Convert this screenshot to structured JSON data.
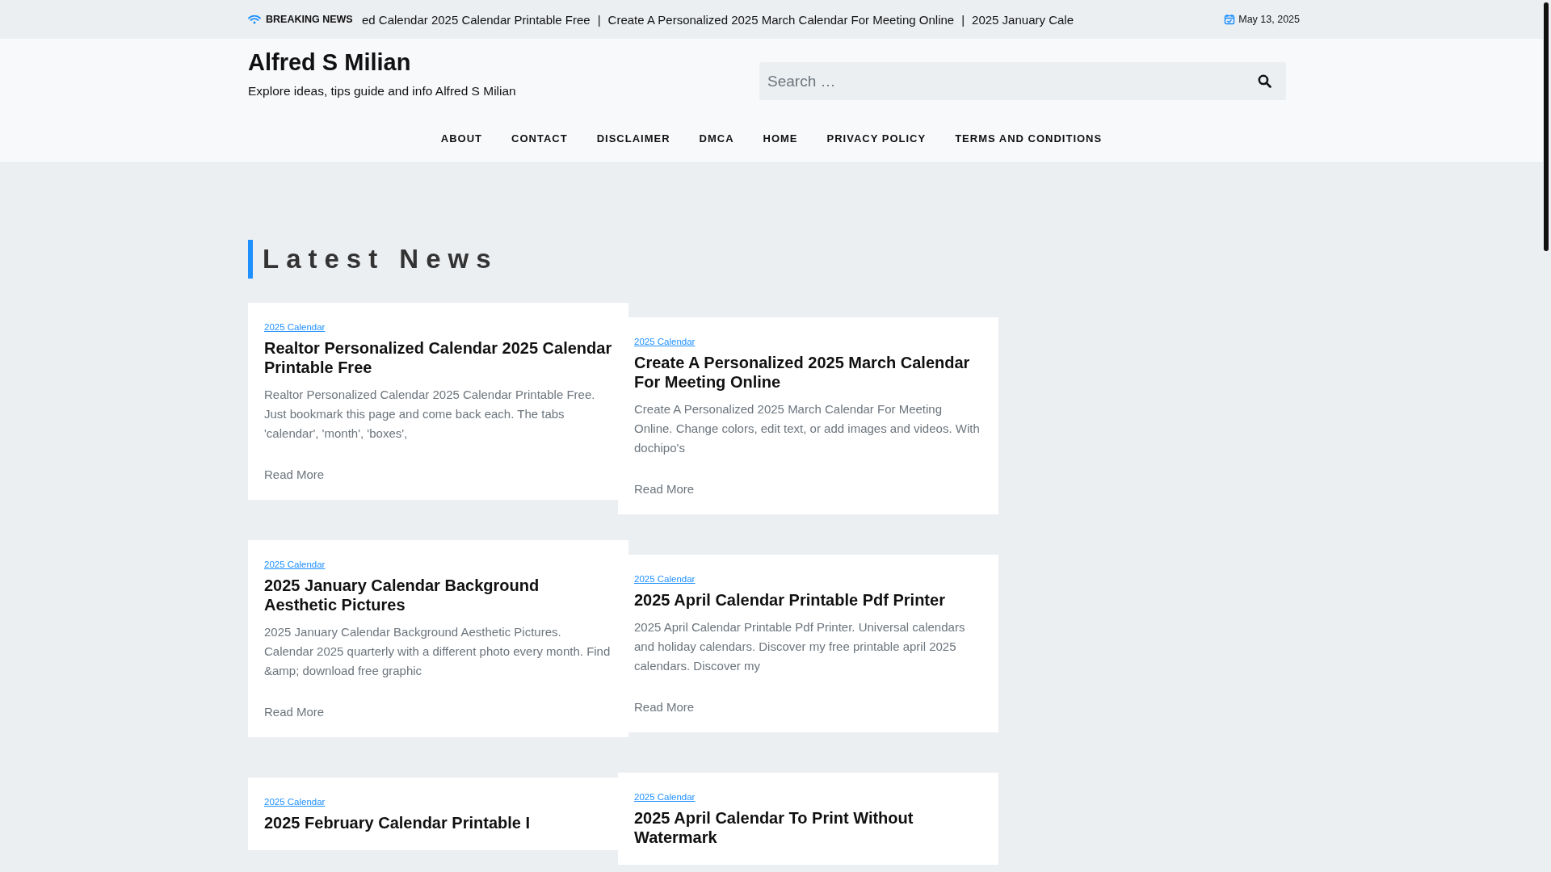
{
  "top_bar": {
    "breaking_label": "BREAKING NEWS",
    "ticker_items": [
      "ed Calendar 2025 Calendar Printable Free",
      "Create A Personalized 2025 March Calendar For Meeting Online",
      "2025 January Cale"
    ],
    "separator": "|",
    "date": "May 13, 2025"
  },
  "header": {
    "site_title": "Alfred S Milian",
    "tagline": "Explore ideas, tips guide and info Alfred S Milian",
    "search": {
      "placeholder": "Search …"
    }
  },
  "nav": [
    "ABOUT",
    "CONTACT",
    "DISCLAIMER",
    "DMCA",
    "HOME",
    "PRIVACY POLICY",
    "TERMS AND CONDITIONS"
  ],
  "section_title": "Latest News",
  "columns": [
    [
      {
        "category": "2025 Calendar",
        "title": "Realtor Personalized Calendar 2025 Calendar Printable Free",
        "excerpt": "Realtor Personalized Calendar 2025 Calendar Printable Free. Just bookmark this page and come back each. The tabs 'calendar', 'month', 'boxes',",
        "read_more": "Read More"
      },
      {
        "category": "2025 Calendar",
        "title": "2025 January Calendar Background Aesthetic Pictures",
        "excerpt": "2025 January Calendar Background Aesthetic Pictures. Calendar 2025 quarterly with a different photo every month. Find &amp; download free graphic",
        "read_more": "Read More"
      },
      {
        "category": "2025 Calendar",
        "title": "2025 February Calendar Printable I"
      }
    ],
    [
      {
        "category": "2025 Calendar",
        "title": "Create A Personalized 2025 March Calendar For Meeting Online",
        "excerpt": "Create A Personalized 2025 March Calendar For Meeting Online. Change colors, edit text, or add images and videos. With dochipo's",
        "read_more": "Read More"
      },
      {
        "category": "2025 Calendar",
        "title": "2025 April Calendar Printable Pdf Printer",
        "excerpt": "2025 April Calendar Printable Pdf Printer. Universal calendars and holiday calendars. Discover my free printable april 2025 calendars. Discover my",
        "read_more": "Read More"
      },
      {
        "category": "2025 Calendar",
        "title": "2025 April Calendar To Print Without Watermark"
      }
    ]
  ]
}
